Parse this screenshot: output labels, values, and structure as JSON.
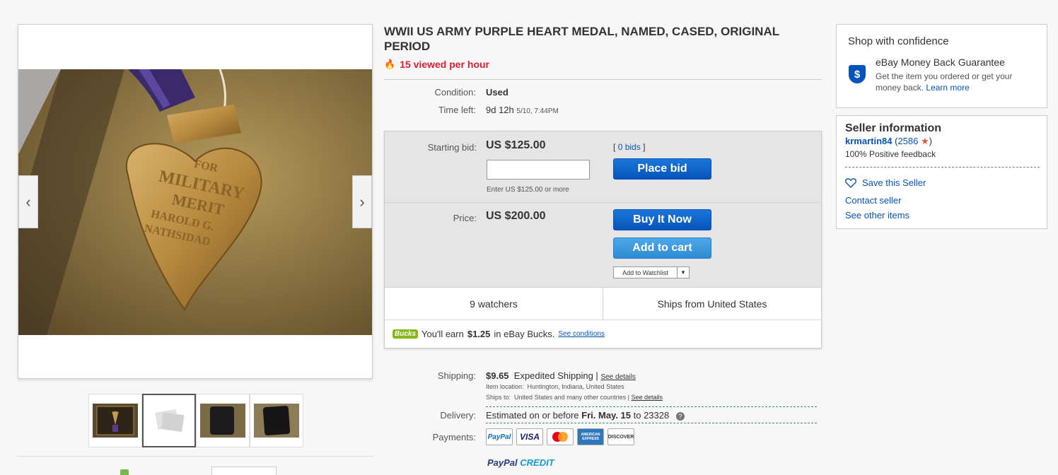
{
  "listing": {
    "title": "WWII US ARMY PURPLE HEART MEDAL, NAMED, CASED, ORIGINAL PERIOD",
    "views": "15 viewed per hour",
    "condition_label": "Condition:",
    "condition_value": "Used",
    "time_label": "Time left:",
    "time_value": "9d 12h",
    "time_end": "5/10, 7:44PM"
  },
  "gallery": {
    "prev": "‹",
    "next": "›",
    "photo_text": [
      "FOR",
      "MILITARY",
      "MERIT",
      "HAROLD G.",
      "NATHSIDAD"
    ]
  },
  "bidding": {
    "starting_label": "Starting bid:",
    "starting_value": "US $125.00",
    "bids_open": "[",
    "bids_link": "0 bids",
    "bids_close": "]",
    "input_value": "",
    "enter_note": "Enter US $125.00 or more",
    "place_bid": "Place bid",
    "price_label": "Price:",
    "price_value": "US $200.00",
    "buy_now": "Buy It Now",
    "add_cart": "Add to cart",
    "watchlist": "Add to Watchlist",
    "watchers": "9 watchers",
    "ships_from": "Ships from United States",
    "bucks_logo": "Bucks",
    "bucks_pre": "You'll earn",
    "bucks_amount": "$1.25",
    "bucks_post": "in eBay Bucks.",
    "see_conditions": "See conditions"
  },
  "shipping": {
    "label": "Shipping:",
    "cost": "$9.65",
    "method": "Expedited Shipping |",
    "details": "See details",
    "location_label": "Item location:",
    "location": "Huntington, Indiana, United States",
    "ships_to_label": "Ships to:",
    "ships_to": "United States and many other countries |",
    "ships_to_details": "See details",
    "delivery_label": "Delivery:",
    "delivery_pre": "Estimated on or before",
    "delivery_date": "Fri. May. 15",
    "delivery_post": "to 23328",
    "help": "?",
    "payments_label": "Payments:",
    "payment_logos": [
      "PayPal",
      "VISA",
      "mastercard",
      "AMERICAN EXPRESS",
      "DISCOVER"
    ],
    "paypal_credit_1": "PayPal",
    "paypal_credit_2": "CREDIT"
  },
  "confidence": {
    "title": "Shop with confidence",
    "guarantee_title": "eBay Money Back Guarantee",
    "guarantee_text": "Get the item you ordered or get your money back.",
    "learn_more": "Learn more",
    "shield": "$"
  },
  "seller": {
    "title": "Seller information",
    "name": "krmartin84",
    "score_open": "(",
    "score": "2586",
    "score_close": ")",
    "feedback": "100% Positive feedback",
    "save": "Save this Seller",
    "contact": "Contact seller",
    "other": "See other items"
  },
  "colors": {
    "link": "#0654ba",
    "hot": "#dd1e31",
    "button": "#0654ba",
    "star": "#e4572e"
  }
}
